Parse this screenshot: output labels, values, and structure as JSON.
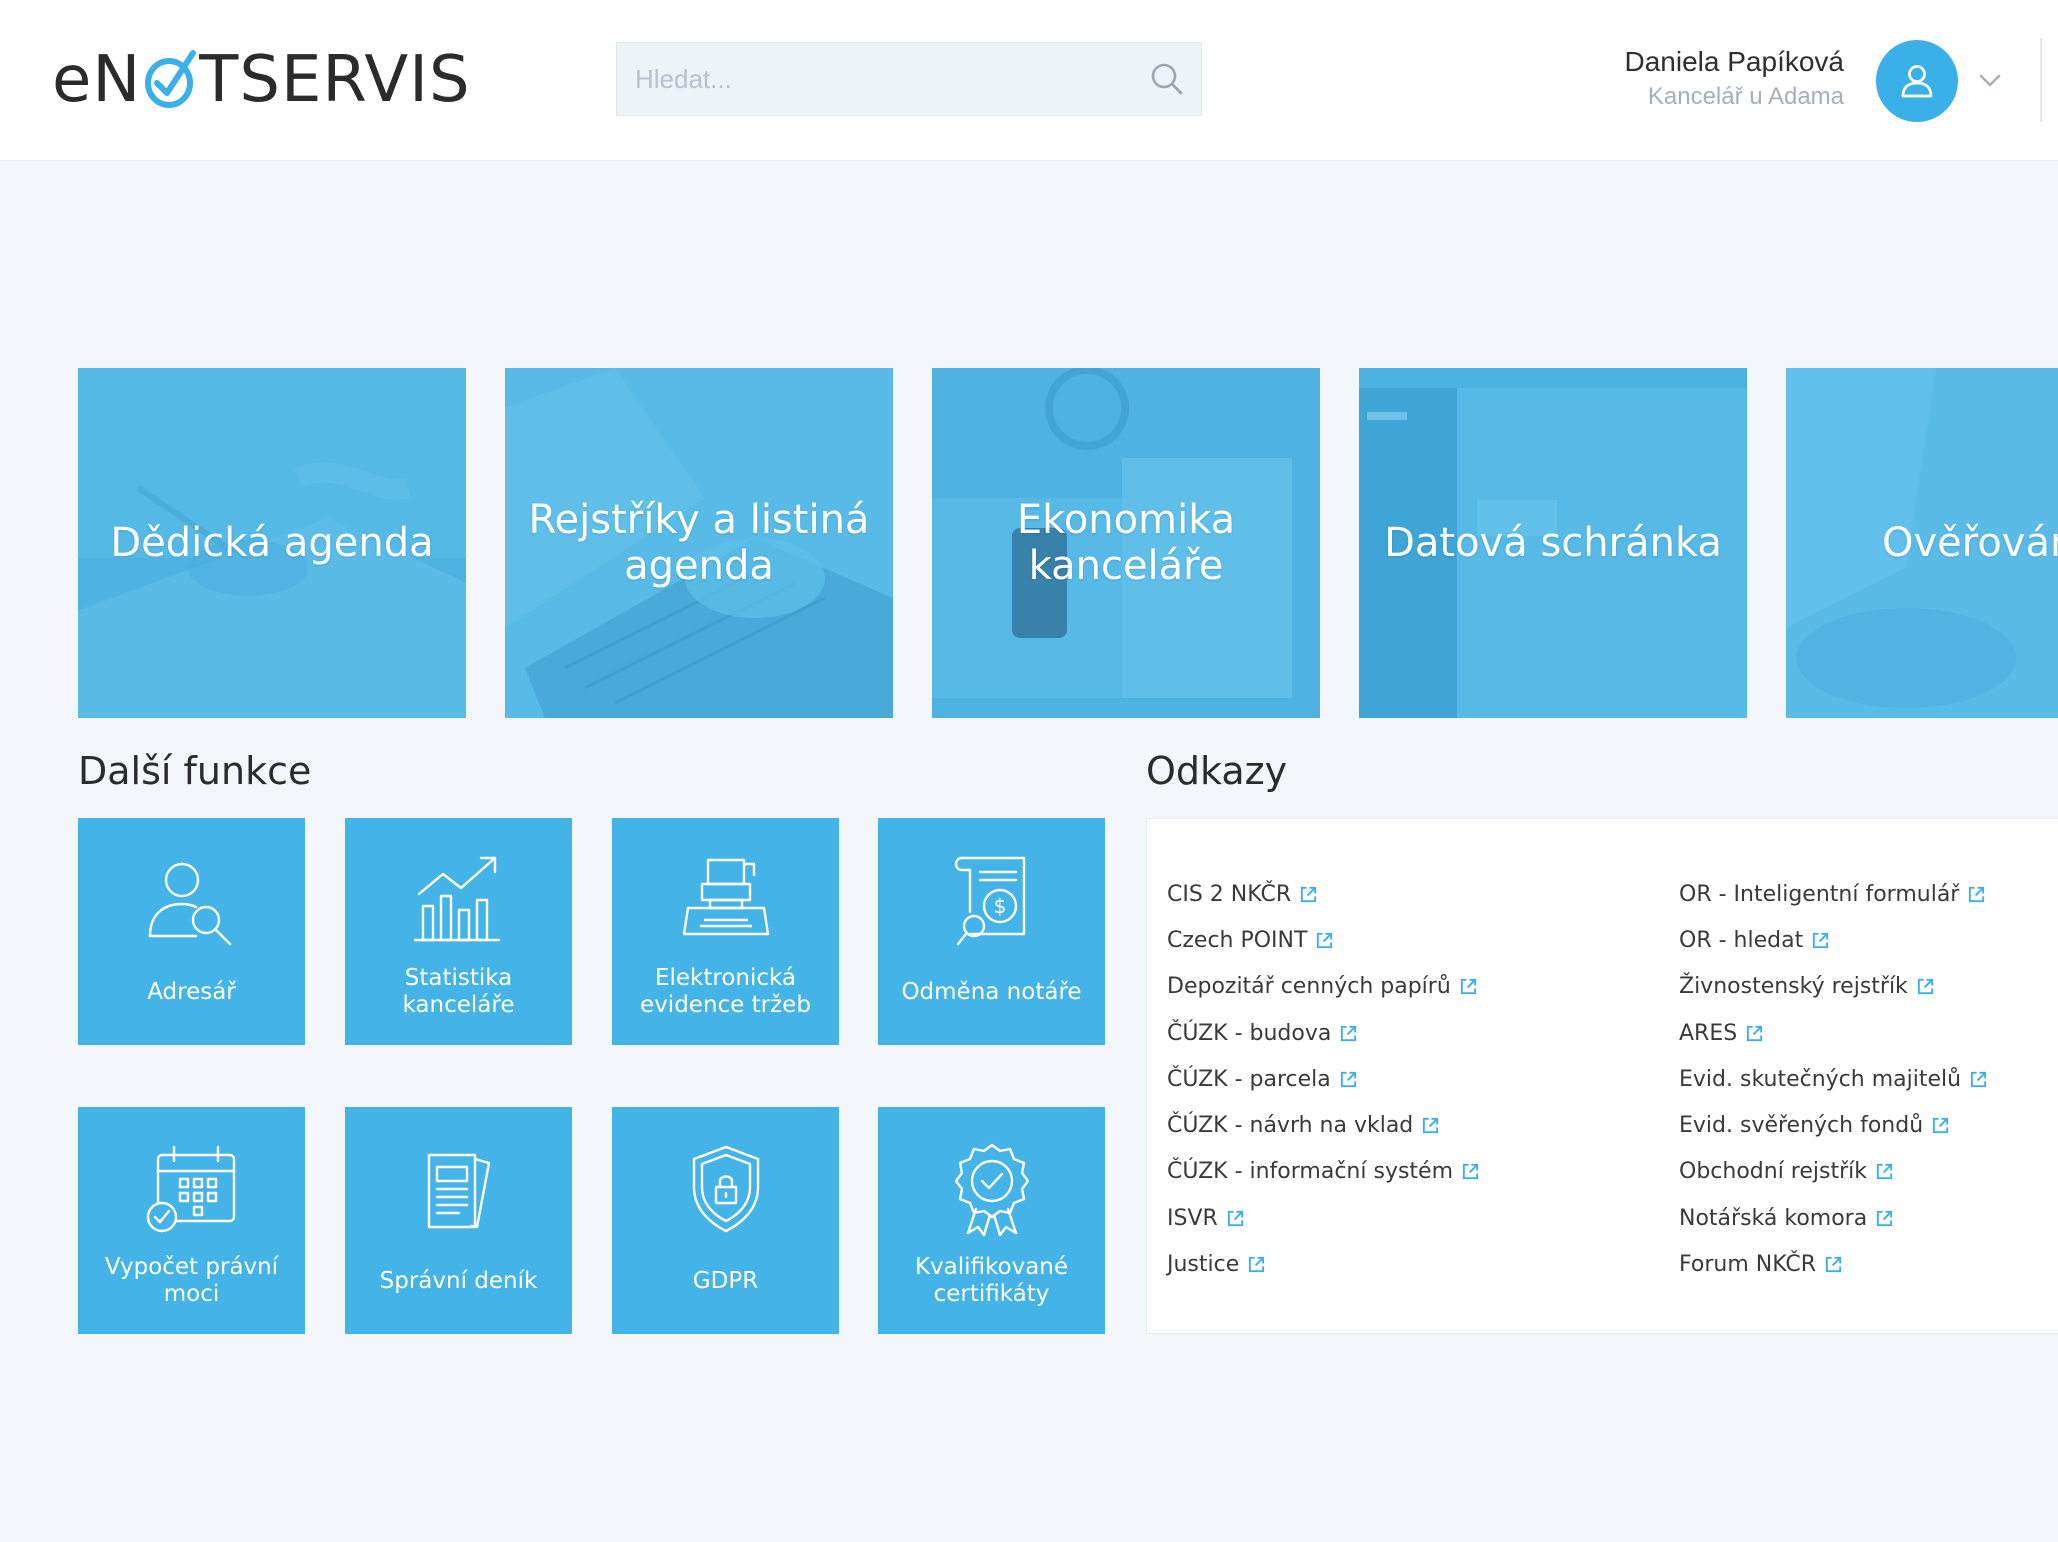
{
  "brand": {
    "logo_prefix": "eN",
    "logo_suffix": "TSERVIS",
    "accent_color": "#44b4e8"
  },
  "search": {
    "placeholder": "Hledat..."
  },
  "user": {
    "name": "Daniela Papíková",
    "office": "Kancelář u Adama"
  },
  "big_tiles": [
    {
      "label": "Dědická agenda"
    },
    {
      "label": "Rejstříky a listiná agenda"
    },
    {
      "label": "Ekonomika kanceláře"
    },
    {
      "label": "Datová schránka"
    },
    {
      "label": "Ověřován"
    }
  ],
  "more_functions": {
    "title": "Další funkce",
    "items": [
      {
        "label": "Adresář",
        "icon": "address-book-icon"
      },
      {
        "label": "Statistika kanceláře",
        "icon": "statistics-icon"
      },
      {
        "label": "Elektronická evidence tržeb",
        "icon": "cash-register-icon"
      },
      {
        "label": "Odměna notáře",
        "icon": "invoice-icon"
      },
      {
        "label": "Vypočet právní moci",
        "icon": "calendar-icon"
      },
      {
        "label": "Správní deník",
        "icon": "documents-icon"
      },
      {
        "label": "GDPR",
        "icon": "shield-lock-icon"
      },
      {
        "label": "Kvalifikované certifikáty",
        "icon": "certificate-icon"
      }
    ]
  },
  "links": {
    "title": "Odkazy",
    "left": [
      "CIS 2 NKČR",
      "Czech POINT",
      "Depozitář cenných papírů",
      "ČÚZK - budova",
      "ČÚZK - parcela",
      "ČÚZK - návrh na vklad",
      "ČÚZK - informační systém",
      "ISVR",
      "Justice"
    ],
    "right": [
      "OR - Inteligentní formulář",
      "OR - hledat",
      "Živnostenský rejstřík",
      "ARES",
      "Evid. skutečných majitelů",
      "Evid. svěřených fondů",
      "Obchodní rejstřík",
      "Notářská komora",
      "Forum NKČR"
    ]
  }
}
